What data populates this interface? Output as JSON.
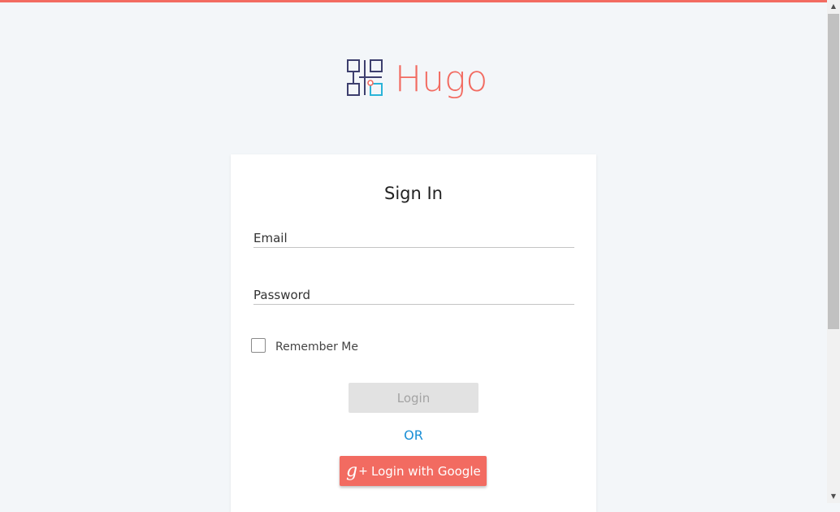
{
  "brand": {
    "name": "Hugo",
    "accent_color": "#f26b61",
    "logo_icon": "grid-squares-logo-icon"
  },
  "signin": {
    "title": "Sign In",
    "email_label": "Email",
    "email_value": "",
    "password_label": "Password",
    "password_value": "",
    "remember_label": "Remember Me",
    "remember_checked": false,
    "login_label": "Login",
    "or_text": "OR",
    "google_icon": "google-plus-icon",
    "google_label": "Login with Google"
  },
  "scrollbar": {
    "up_icon": "▲",
    "down_icon": "▼"
  }
}
